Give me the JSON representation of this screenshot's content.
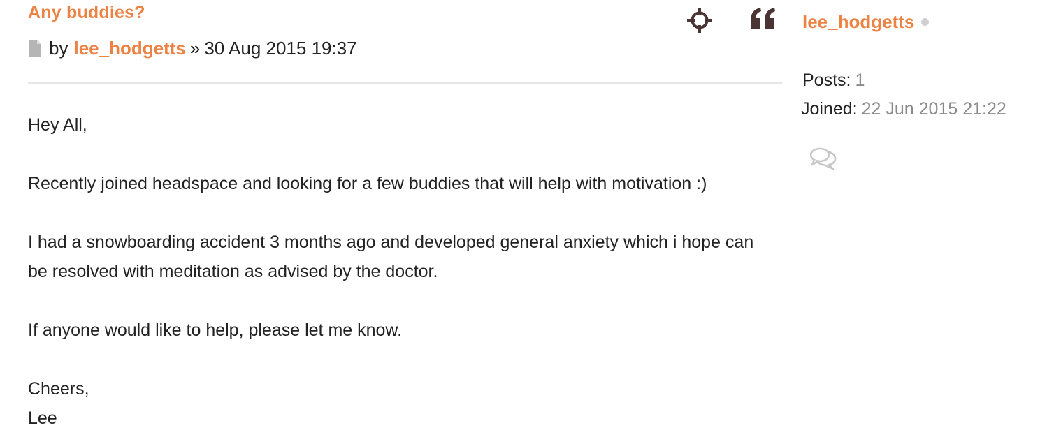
{
  "post": {
    "title": "Any buddies?",
    "meta": {
      "by_label": "by",
      "author": "lee_hodgetts",
      "separator": "»",
      "datetime": "30 Aug 2015 19:37"
    },
    "body": [
      "Hey All,",
      "Recently joined headspace and looking for a few buddies that will help with motivation :)",
      "I had a snowboarding accident 3 months ago and developed general anxiety which i hope can be resolved with meditation as advised by the doctor.",
      "If anyone would like to help, please let me know.",
      "Cheers,",
      "Lee"
    ]
  },
  "profile": {
    "username": "lee_hodgetts",
    "status": "offline",
    "posts_label": "Posts:",
    "posts_value": "1",
    "joined_label": "Joined:",
    "joined_value": "22 Jun 2015 21:22"
  },
  "actions": {
    "report_icon": "crosshair-icon",
    "quote_icon": "quote-icon",
    "pm_icon": "chat-bubbles-icon"
  },
  "colors": {
    "accent": "#ec8344",
    "icon_dark": "#4a3434",
    "muted": "#8a8a8a",
    "divider": "#e6e6e6",
    "online_dot": "#cfcfcf"
  }
}
